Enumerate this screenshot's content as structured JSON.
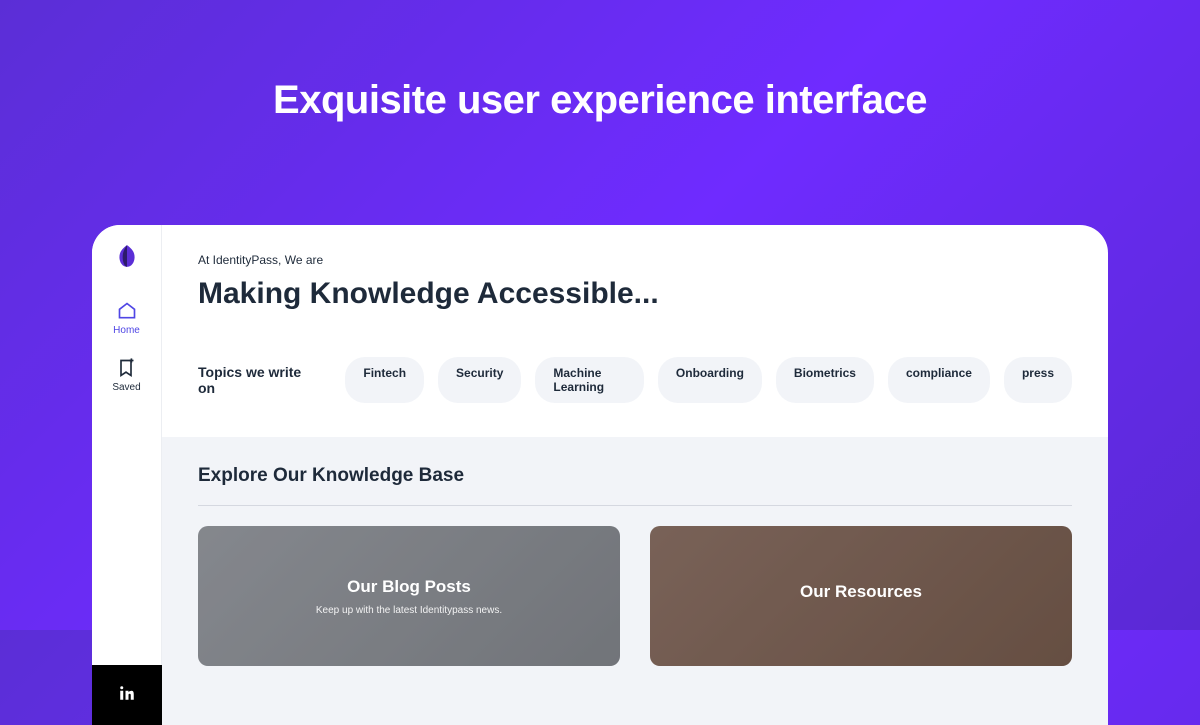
{
  "hero": {
    "title": "Exquisite user experience interface"
  },
  "sidebar": {
    "nav": [
      {
        "label": "Home"
      },
      {
        "label": "Saved"
      }
    ]
  },
  "header": {
    "pretitle": "At IdentityPass, We are",
    "title": "Making Knowledge Accessible..."
  },
  "topics": {
    "label": "Topics we write on",
    "items": [
      "Fintech",
      "Security",
      "Machine Learning",
      "Onboarding",
      "Biometrics",
      "compliance",
      "press"
    ]
  },
  "kb": {
    "title": "Explore Our Knowledge Base",
    "cards": [
      {
        "title": "Our Blog Posts",
        "sub": "Keep up with the latest Identitypass news."
      },
      {
        "title": "Our Resources",
        "sub": ""
      }
    ]
  }
}
